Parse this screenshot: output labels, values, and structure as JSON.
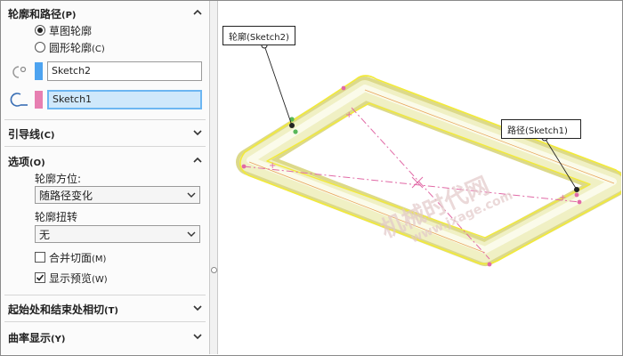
{
  "profile_path": {
    "title": "轮廓和路径",
    "title_key": "(P)",
    "options": [
      {
        "label": "草图轮廓",
        "key": "",
        "selected": true
      },
      {
        "label": "圆形轮廓",
        "key": "(C)",
        "selected": false
      }
    ],
    "profile_field": {
      "value": "Sketch2",
      "color": "#4da3f0"
    },
    "path_field": {
      "value": "Sketch1",
      "color": "#e77fb1"
    }
  },
  "guide_curves": {
    "title": "引导线",
    "title_key": "(C)"
  },
  "options": {
    "title": "选项",
    "title_key": "(O)",
    "orientation_label": "轮廓方位:",
    "orientation_value": "随路径变化",
    "twist_label": "轮廓扭转",
    "twist_value": "无",
    "merge_label": "合并切面",
    "merge_key": "(M)",
    "merge_checked": false,
    "preview_label": "显示预览",
    "preview_key": "(W)",
    "preview_checked": true
  },
  "start_end": {
    "title": "起始处和结束处相切",
    "title_key": "(T)"
  },
  "curvature": {
    "title": "曲率显示",
    "title_key": "(Y)"
  },
  "viewport": {
    "callout_profile": "轮廓(Sketch2)",
    "callout_path": "路径(Sketch1)",
    "watermark_cn": "机械时代网",
    "watermark_url": "www.jxage.com"
  }
}
